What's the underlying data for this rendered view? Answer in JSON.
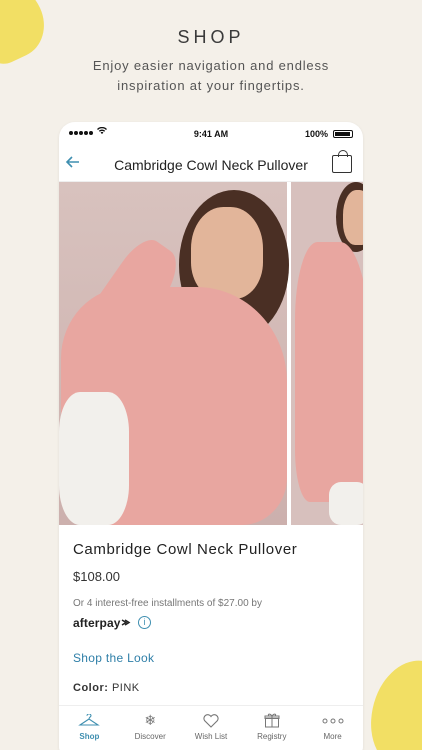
{
  "promo": {
    "title": "SHOP",
    "subtitle_line1": "Enjoy easier navigation and endless",
    "subtitle_line2": "inspiration at your fingertips."
  },
  "status_bar": {
    "time": "9:41 AM",
    "battery": "100%"
  },
  "nav": {
    "title": "Cambridge Cowl Neck Pullover"
  },
  "product": {
    "name": "Cambridge Cowl Neck Pullover",
    "price": "$108.00",
    "installments": "Or 4 interest-free installments of $27.00 by",
    "afterpay": "afterpay",
    "shop_the_look": "Shop the Look",
    "color_label": "Color:",
    "color_value": "PINK"
  },
  "tabs": [
    {
      "label": "Shop",
      "icon": "hanger-icon"
    },
    {
      "label": "Discover",
      "icon": "snowflake-icon"
    },
    {
      "label": "Wish List",
      "icon": "heart-icon"
    },
    {
      "label": "Registry",
      "icon": "gift-icon"
    },
    {
      "label": "More",
      "icon": "more-icon"
    }
  ],
  "colors": {
    "accent": "#3f8fb0",
    "background": "#f4f0e9",
    "splash": "#f2df64",
    "sweater": "#e8a6a0"
  }
}
